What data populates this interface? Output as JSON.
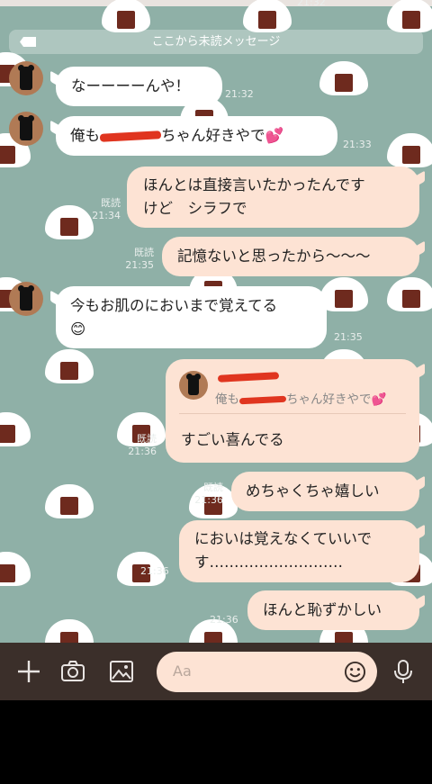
{
  "divider": {
    "label": "ここから未読メッセージ"
  },
  "top_time": "21:32",
  "messages": [
    {
      "id": "m1",
      "text": "なーーーーんや！",
      "time": "21:32"
    },
    {
      "id": "m2",
      "text_pre": "俺も",
      "text_post": "ちゃん好きやで",
      "emoji": "💕",
      "time": "21:33"
    },
    {
      "id": "m3",
      "lines": [
        "ほんとは直接言いたかったんです",
        "けど　シラフで"
      ],
      "read": "既読",
      "time": "21:34"
    },
    {
      "id": "m4",
      "text": "記憶ないと思ったから〜〜〜",
      "read": "既読",
      "time": "21:35"
    },
    {
      "id": "m5",
      "text": "今もお肌のにおいまで覚えてる",
      "emoji": "😊",
      "time": "21:35"
    },
    {
      "id": "m6",
      "quote_pre": "俺も",
      "quote_post": "ちゃん好きやで",
      "quote_emoji": "💕",
      "text": "すごい喜んでる",
      "read": "既読",
      "time": "21:36"
    },
    {
      "id": "m7",
      "text": "めちゃくちゃ嬉しい",
      "read": "既読",
      "time": "21:36"
    },
    {
      "id": "m8",
      "lines": [
        "においは覚えなくていいで",
        "す………………………"
      ],
      "time": "21:36"
    },
    {
      "id": "m9",
      "text": "ほんと恥ずかしい",
      "time": "21:36"
    }
  ],
  "input": {
    "placeholder": "Aa"
  },
  "icons": [
    "plus-icon",
    "camera-icon",
    "image-icon",
    "emoji-icon",
    "microphone-icon"
  ],
  "colors": {
    "wallpaper": "#8fb0a7",
    "bubble_out": "#fde3d4",
    "bubble_in": "#ffffff",
    "input_bar": "#3b2f2a",
    "redaction": "#e0351f"
  }
}
